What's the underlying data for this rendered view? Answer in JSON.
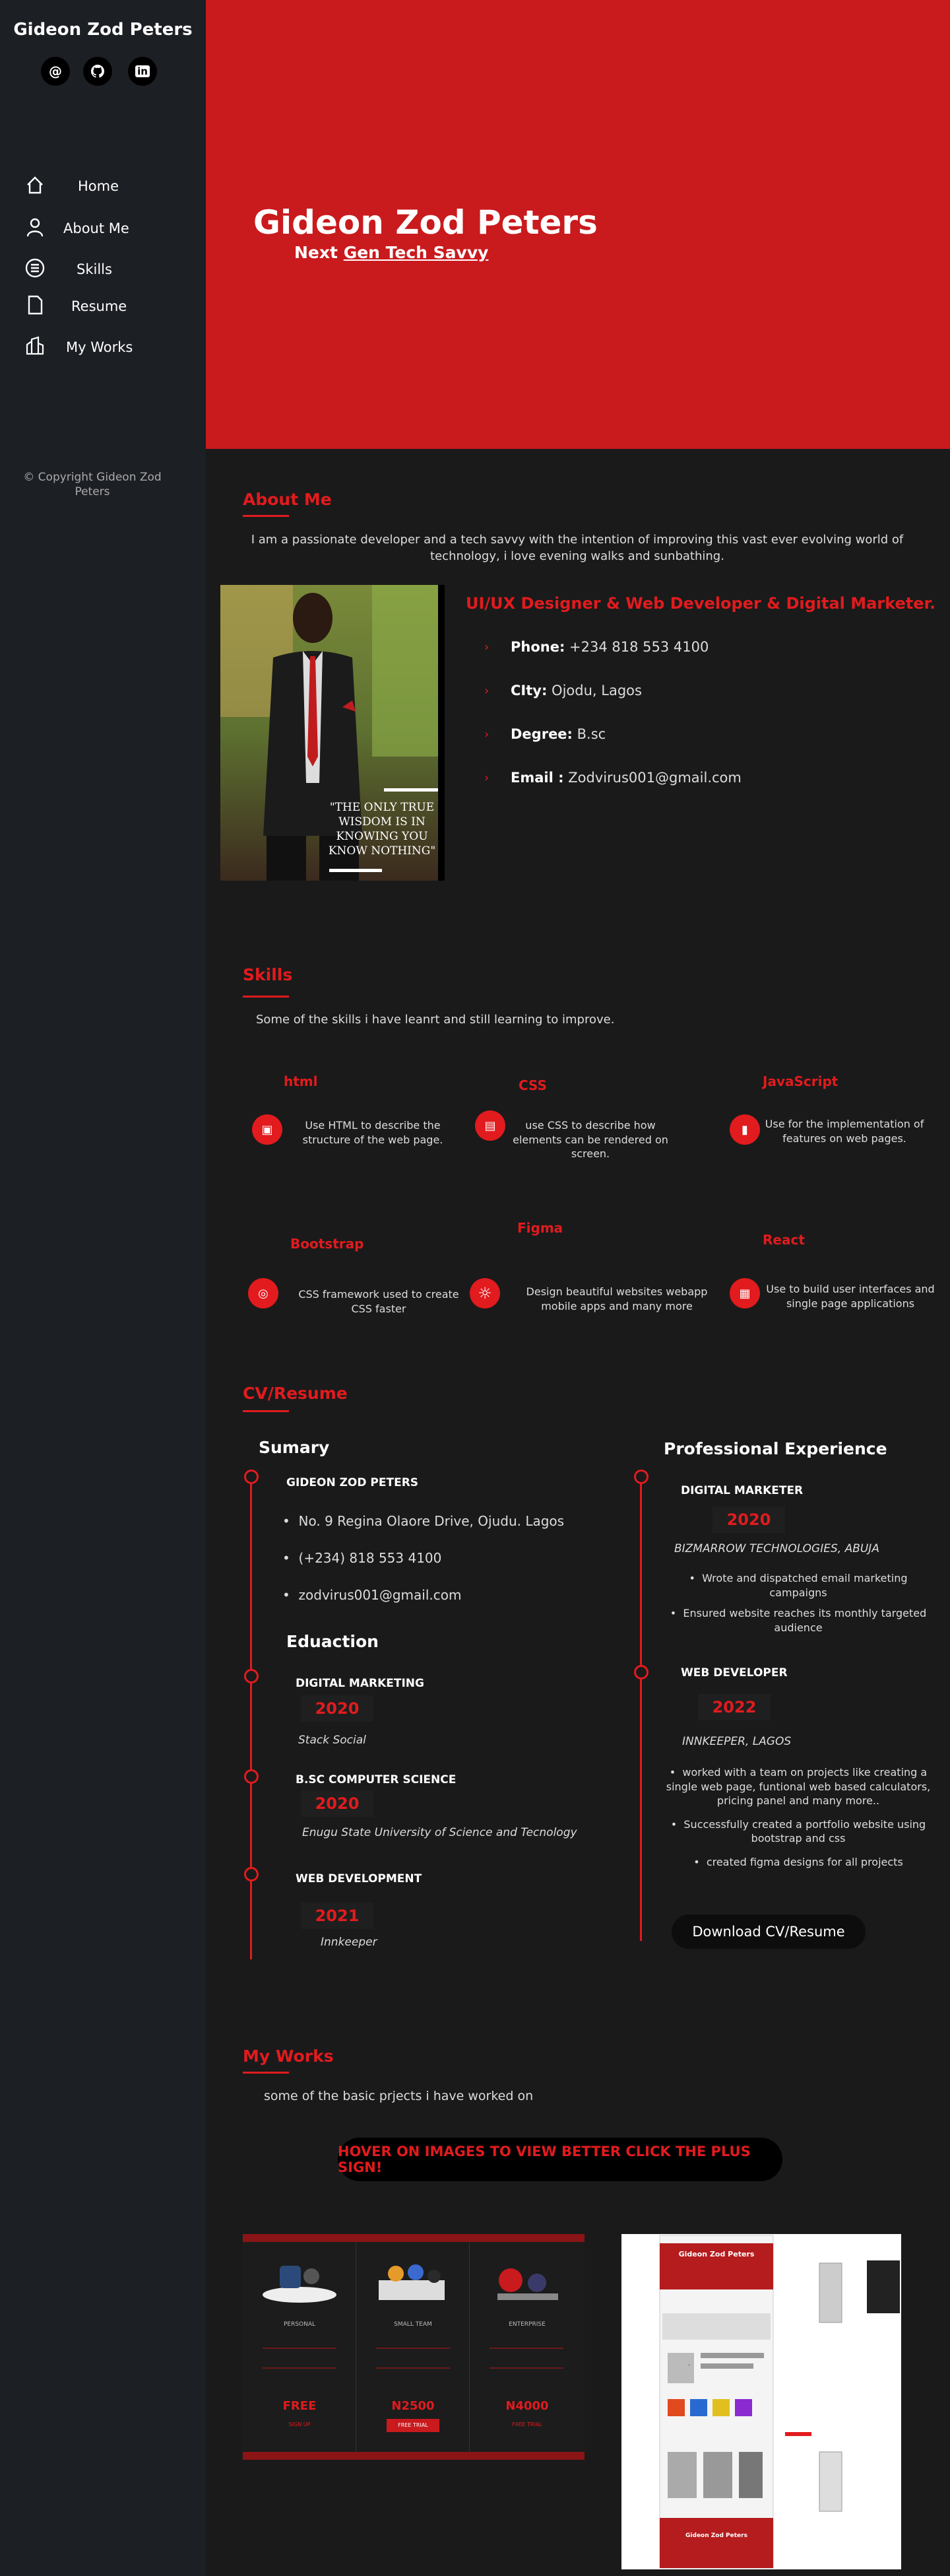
{
  "sidebar": {
    "name": "Gideon Zod Peters",
    "social": [
      {
        "icon": "at-sign-icon",
        "glyph": "@"
      },
      {
        "icon": "github-icon",
        "glyph": "⊙"
      },
      {
        "icon": "linkedin-icon",
        "glyph": "in"
      }
    ],
    "nav": [
      {
        "label": "Home",
        "icon": "home-icon"
      },
      {
        "label": "About Me",
        "icon": "user-icon"
      },
      {
        "label": "Skills",
        "icon": "list-icon"
      },
      {
        "label": "Resume",
        "icon": "file-icon"
      },
      {
        "label": "My Works",
        "icon": "portfolio-icon"
      }
    ],
    "copyright": "© Copyright Gideon Zod Peters"
  },
  "hero": {
    "title": "Gideon Zod Peters",
    "sub_prefix": "Next",
    "sub_link": "Gen Tech Savvy"
  },
  "about": {
    "title": "About Me",
    "text": "I am a passionate developer and a tech savvy with the intention of improving this vast ever evolving world of technology, i love evening walks and sunbathing.",
    "photo_quote": "\"THE ONLY TRUE WISDOM IS IN KNOWING YOU KNOW NOTHING\"",
    "role": "UI/UX Designer & Web Developer & Digital Marketer.",
    "info": [
      {
        "label": "Phone:",
        "value": "+234 818 553 4100"
      },
      {
        "label": "CIty:",
        "value": "Ojodu, Lagos"
      },
      {
        "label": "Degree:",
        "value": "B.sc"
      },
      {
        "label": "Email :",
        "value": "Zodvirus001@gmail.com"
      }
    ]
  },
  "skills": {
    "title": "Skills",
    "intro": "Some of the skills i have leanrt and still learning to improve.",
    "items": [
      {
        "name": "html",
        "desc": "Use HTML to describe the structure of the web page.",
        "icon": "briefcase-icon",
        "glyph": "▣"
      },
      {
        "name": "CSS",
        "desc": "use CSS to describe how elements can be rendered on screen.",
        "icon": "card-icon",
        "glyph": "▤"
      },
      {
        "name": "JavaScript",
        "desc": "Use for the implementation of features on web pages.",
        "icon": "bar-chart-icon",
        "glyph": "▮"
      },
      {
        "name": "Bootstrap",
        "desc": "CSS framework used to create CSS faster",
        "icon": "binoculars-icon",
        "glyph": "◎"
      },
      {
        "name": "Figma",
        "desc": "Design beautiful websites webapp mobile apps and many more",
        "icon": "sun-icon",
        "glyph": "☼"
      },
      {
        "name": "React",
        "desc": "Use to build  user interfaces and single page applications",
        "icon": "calendar-icon",
        "glyph": "▦"
      }
    ]
  },
  "resume": {
    "title": "CV/Resume",
    "summary_heading": "Sumary",
    "summary_name": "GIDEON ZOD PETERS",
    "summary_lines": [
      "No. 9 Regina Olaore Drive, Ojudu. Lagos",
      "(+234) 818 553 4100",
      "zodvirus001@gmail.com"
    ],
    "education_heading": "Eduaction",
    "education": [
      {
        "title": "DIGITAL MARKETING",
        "year": "2020",
        "org": "Stack Social"
      },
      {
        "title": "B.SC COMPUTER SCIENCE",
        "year": "2020",
        "org": "Enugu State University of Science and Tecnology"
      },
      {
        "title": "WEB DEVELOPMENT",
        "year": "2021",
        "org": "Innkeeper"
      }
    ],
    "experience_heading": "Professional Experience",
    "experience": [
      {
        "title": "DIGITAL MARKETER",
        "year": "2020",
        "org": "BIZMARROW TECHNOLOGIES, ABUJA",
        "points": [
          "Wrote and dispatched email marketing campaigns",
          "Ensured website reaches its monthly targeted audience"
        ]
      },
      {
        "title": "WEB DEVELOPER",
        "year": "2022",
        "org": "INNKEEPER, LAGOS",
        "points": [
          "worked with a team on projects like creating a single web page, funtional web based calculators, pricing panel and many more..",
          "Successfully created a portfolio website using bootstrap and css",
          "created figma designs for all projects"
        ]
      }
    ],
    "download_label": "Download CV/Resume"
  },
  "works": {
    "title": "My Works",
    "intro": "some of the basic prjects i have worked on",
    "hover_label": "HOVER ON IMAGES TO VIEW BETTER CLICK THE PLUS SIGN!",
    "pricing": [
      {
        "tier": "PERSONAL",
        "price": "FREE",
        "cta": "SIGN UP"
      },
      {
        "tier": "SMALL TEAM",
        "price": "N2500",
        "cta": "FREE TRIAL"
      },
      {
        "tier": "ENTERPRISE",
        "price": "N4000",
        "cta": "FREE TRIAL"
      }
    ],
    "mock_title": "Gideon Zod Peters"
  }
}
